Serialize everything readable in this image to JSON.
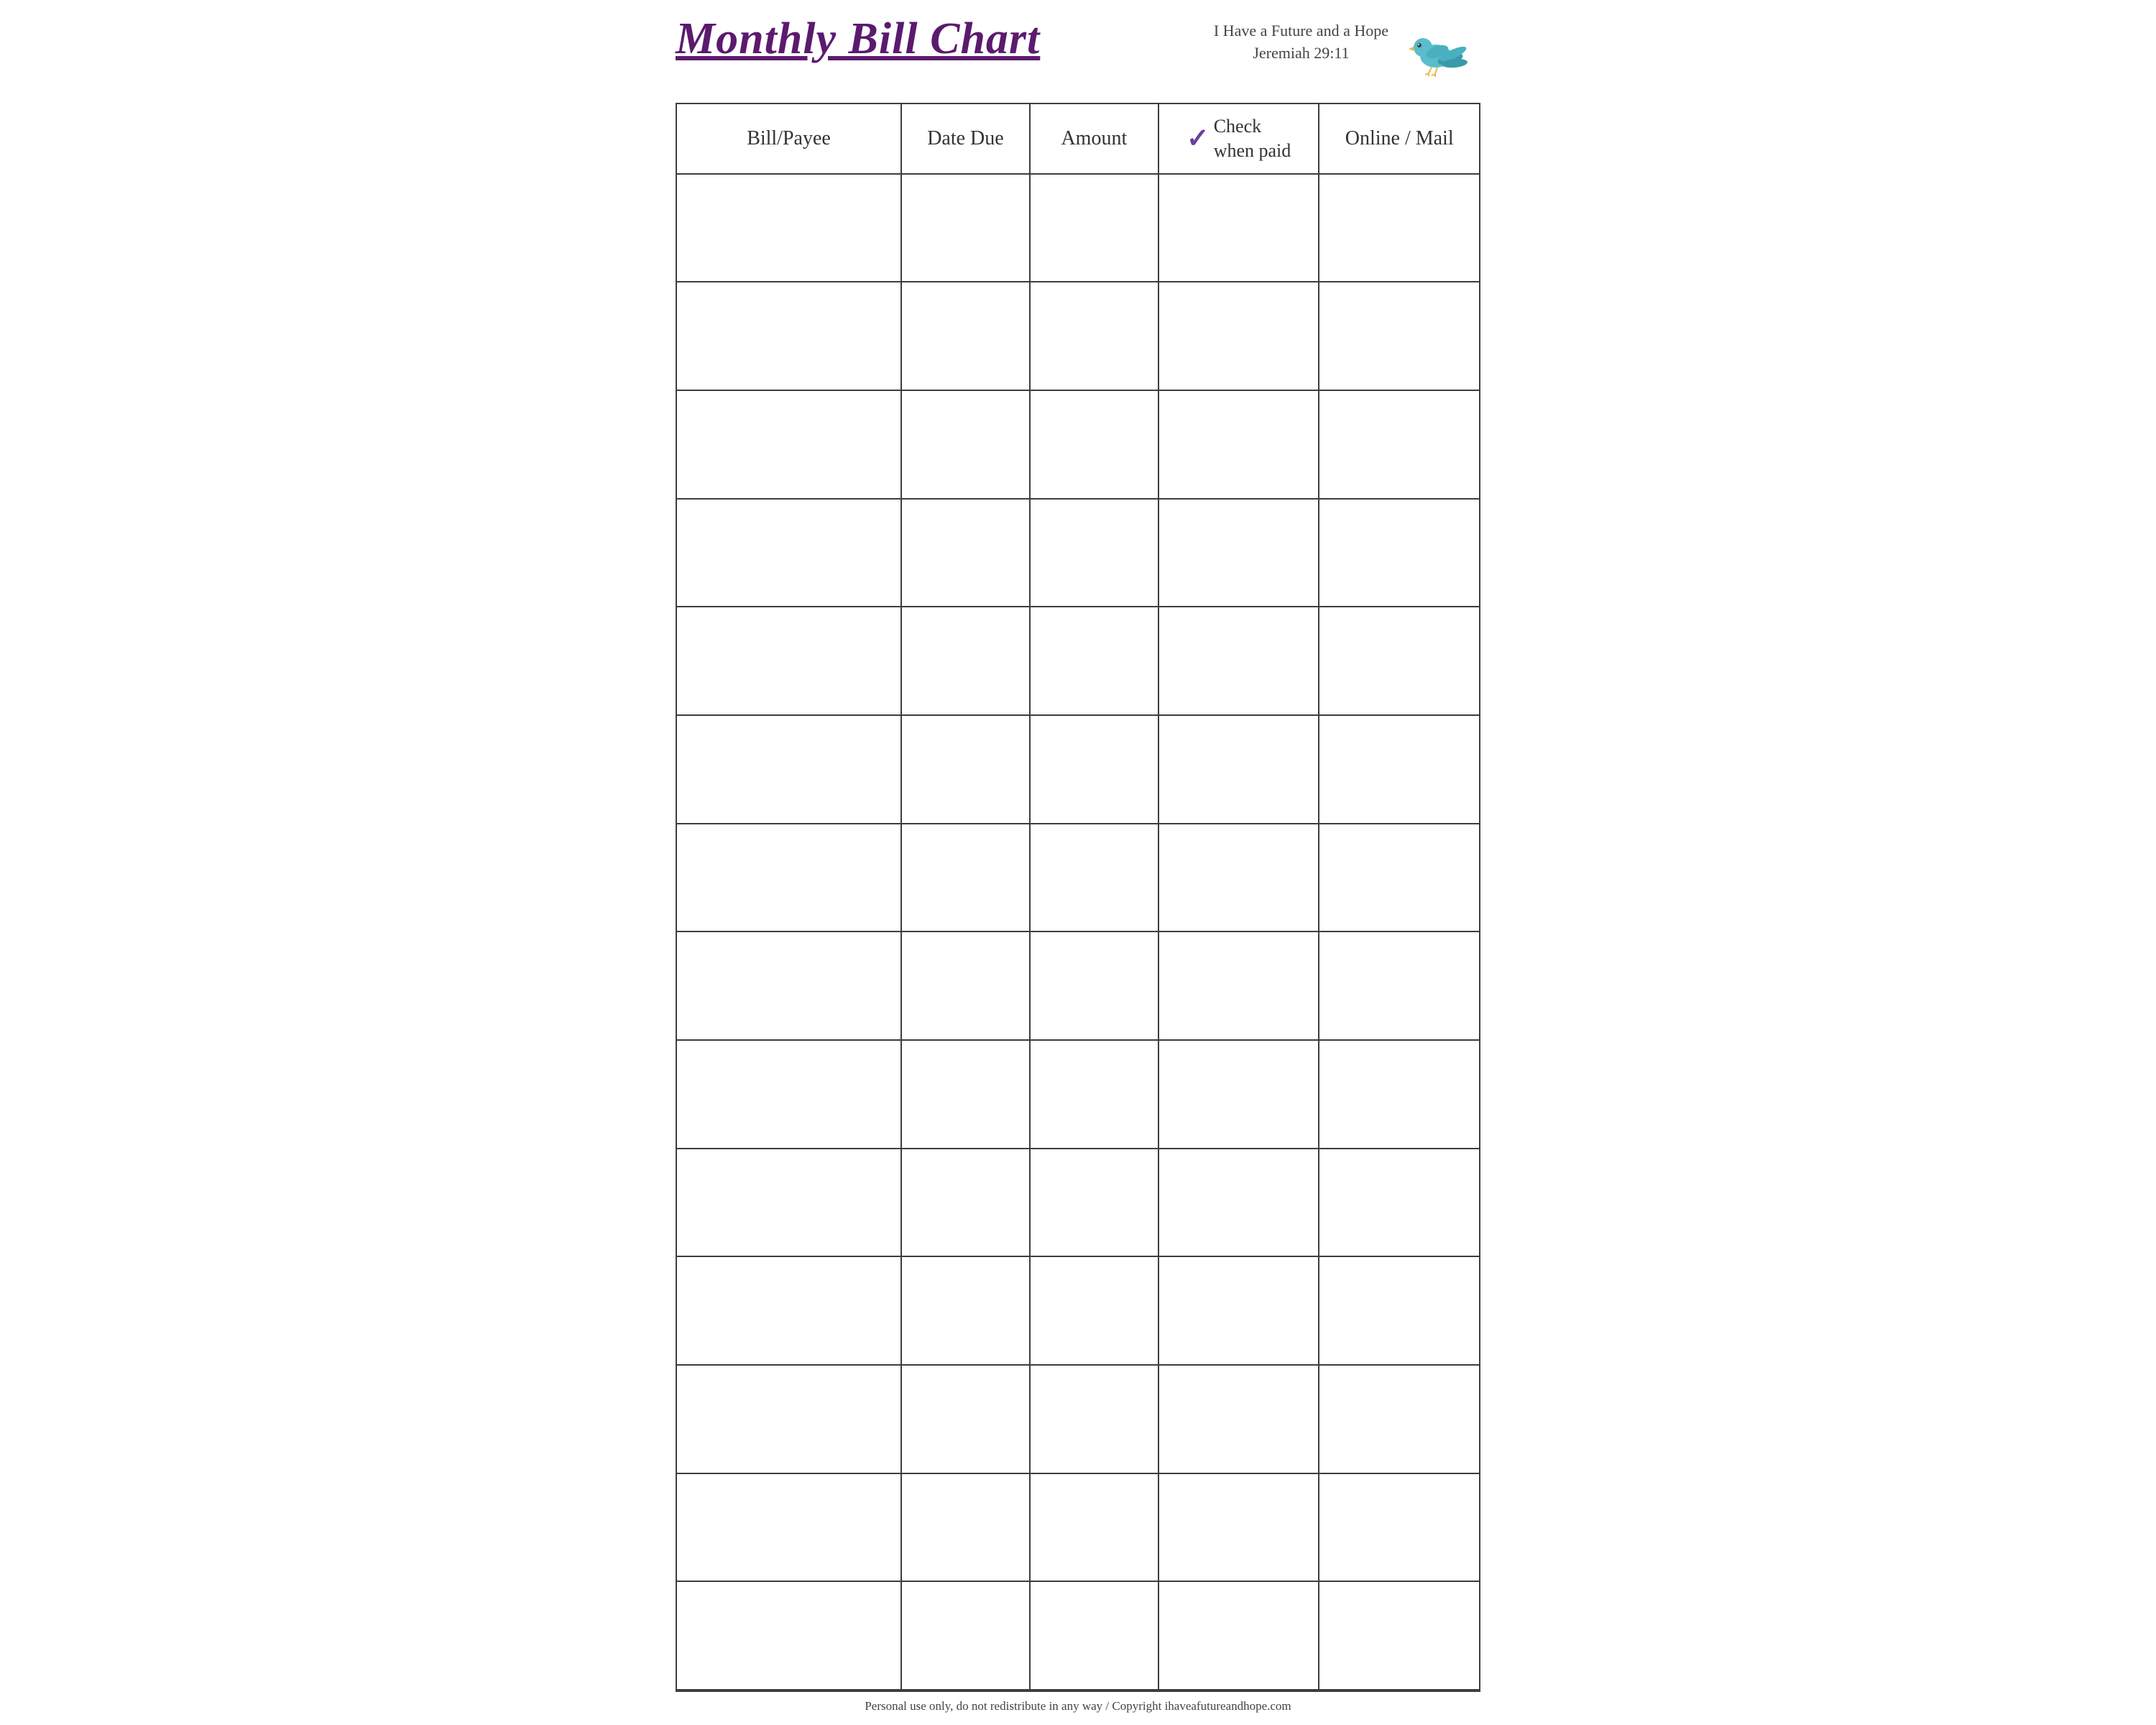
{
  "header": {
    "title": "Monthly Bill Chart",
    "verse_line1": "I Have a Future and a Hope",
    "verse_line2": "Jeremiah 29:11"
  },
  "table": {
    "columns": [
      {
        "id": "bill",
        "label": "Bill/Payee"
      },
      {
        "id": "date",
        "label": "Date Due"
      },
      {
        "id": "amount",
        "label": "Amount"
      },
      {
        "id": "check",
        "label": "Check when paid",
        "has_checkmark": true
      },
      {
        "id": "online",
        "label": "Online / Mail"
      }
    ],
    "row_count": 14
  },
  "footer": {
    "text": "Personal use only, do not redistribute in any way / Copyright ihaveafutureandhope.com"
  },
  "colors": {
    "title": "#5b1a6e",
    "border": "#3d3d3d",
    "checkmark": "#6a3fa0",
    "text": "#333333",
    "footer_text": "#444444"
  }
}
